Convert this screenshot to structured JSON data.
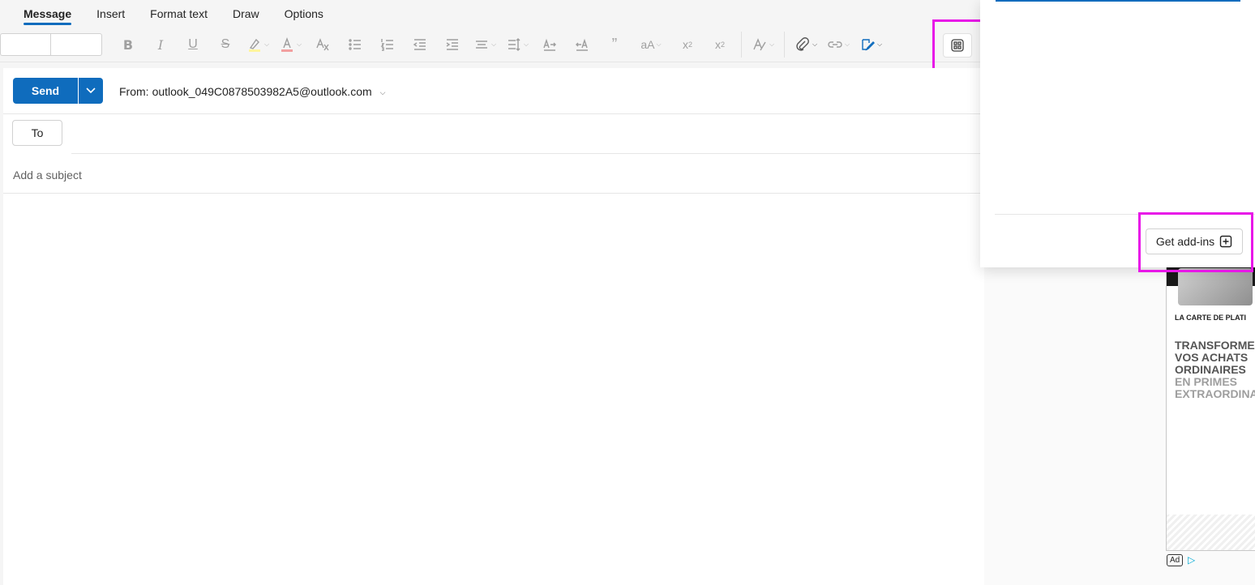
{
  "ribbon": {
    "tabs": [
      {
        "label": "Message",
        "active": true
      },
      {
        "label": "Insert",
        "active": false
      },
      {
        "label": "Format text",
        "active": false
      },
      {
        "label": "Draw",
        "active": false
      },
      {
        "label": "Options",
        "active": false
      }
    ]
  },
  "toolbar": {
    "buttons": [
      "bold-icon",
      "italic-icon",
      "underline-icon",
      "strikethrough-icon",
      "highlight-icon",
      "font-color-icon",
      "clear-format-icon",
      "bullets-icon",
      "numbering-icon",
      "decrease-indent-icon",
      "increase-indent-icon",
      "align-icon",
      "spacing-icon",
      "ltr-icon",
      "rtl-icon",
      "quote-icon",
      "change-case-icon",
      "subscript-icon",
      "superscript-icon",
      "styles-icon",
      "attach-icon",
      "link-icon",
      "signature-icon",
      "apps-icon"
    ],
    "highlight_color": "#fff100",
    "font_color": "#e8242c"
  },
  "compose": {
    "send_label": "Send",
    "from_label": "From:",
    "from_address": "outlook_049C0878503982A5@outlook.com",
    "to_label": "To",
    "subject_placeholder": "Add a subject"
  },
  "addins_panel": {
    "get_addins_label": "Get add-ins"
  },
  "ad": {
    "card_text": "LA CARTE DE PLATI",
    "headline_dark": [
      "TRANSFORME",
      "VOS ACHATS",
      "ORDINAIRES"
    ],
    "headline_light": [
      "EN PRIMES",
      "EXTRAORDINA"
    ],
    "badge": "Ad"
  },
  "colors": {
    "accent": "#0f6cbd",
    "highlight_box": "#e816e8"
  }
}
